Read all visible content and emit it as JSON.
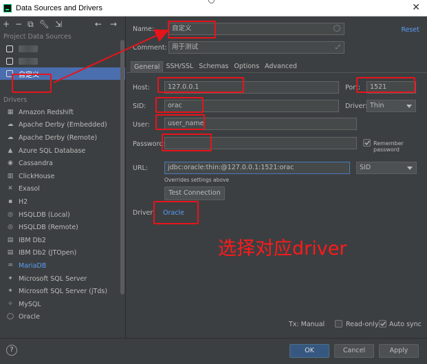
{
  "window": {
    "title": "Data Sources and Drivers"
  },
  "toolbar": {
    "icons": [
      "plus-icon",
      "minus-icon",
      "copy-icon",
      "wrench-icon",
      "import-icon",
      "back-arrow-icon",
      "forward-arrow-icon"
    ]
  },
  "sidebar": {
    "project_header": "Project Data Sources",
    "selected_source": "自定义",
    "drivers_header": "Drivers",
    "drivers": [
      "Amazon Redshift",
      "Apache Derby (Embedded)",
      "Apache Derby (Remote)",
      "Azure SQL Database",
      "Cassandra",
      "ClickHouse",
      "Exasol",
      "H2",
      "HSQLDB (Local)",
      "HSQLDB (Remote)",
      "IBM Db2",
      "IBM Db2 (JTOpen)",
      "MariaDB",
      "Microsoft SQL Server",
      "Microsoft SQL Server (jTds)",
      "MySQL",
      "Oracle"
    ]
  },
  "form": {
    "name_label": "Name:",
    "name_value": "自定义",
    "comment_label": "Comment:",
    "comment_value": "用于测试",
    "reset_label": "Reset",
    "tabs": [
      "General",
      "SSH/SSL",
      "Schemas",
      "Options",
      "Advanced"
    ],
    "host_label": "Host:",
    "host_value": "127.0.0.1",
    "port_label": "Port:",
    "port_value": "1521",
    "sid_label": "SID:",
    "sid_value": "orac",
    "driver_type_label": "Driver:",
    "driver_type_value": "Thin",
    "user_label": "User:",
    "user_value": "user_name",
    "password_label": "Password:",
    "password_value": "",
    "remember_password_label": "Remember password",
    "url_label": "URL:",
    "url_value": "jdbc:oracle:thin:@127.0.0.1:1521:orac",
    "url_type_value": "SID",
    "overrides_note": "Overrides settings above",
    "test_connection_label": "Test Connection",
    "driver_label": "Driver:",
    "driver_link": "Oracle",
    "annotation": "选择对应driver",
    "tx_label": "Tx: Manual",
    "readonly_label": "Read-only",
    "autosync_label": "Auto sync"
  },
  "buttons": {
    "help": "?",
    "ok": "OK",
    "cancel": "Cancel",
    "apply": "Apply"
  },
  "colors": {
    "accent": "#589df6",
    "selection": "#4b6eaf",
    "annotation_red": "#e8141b"
  }
}
